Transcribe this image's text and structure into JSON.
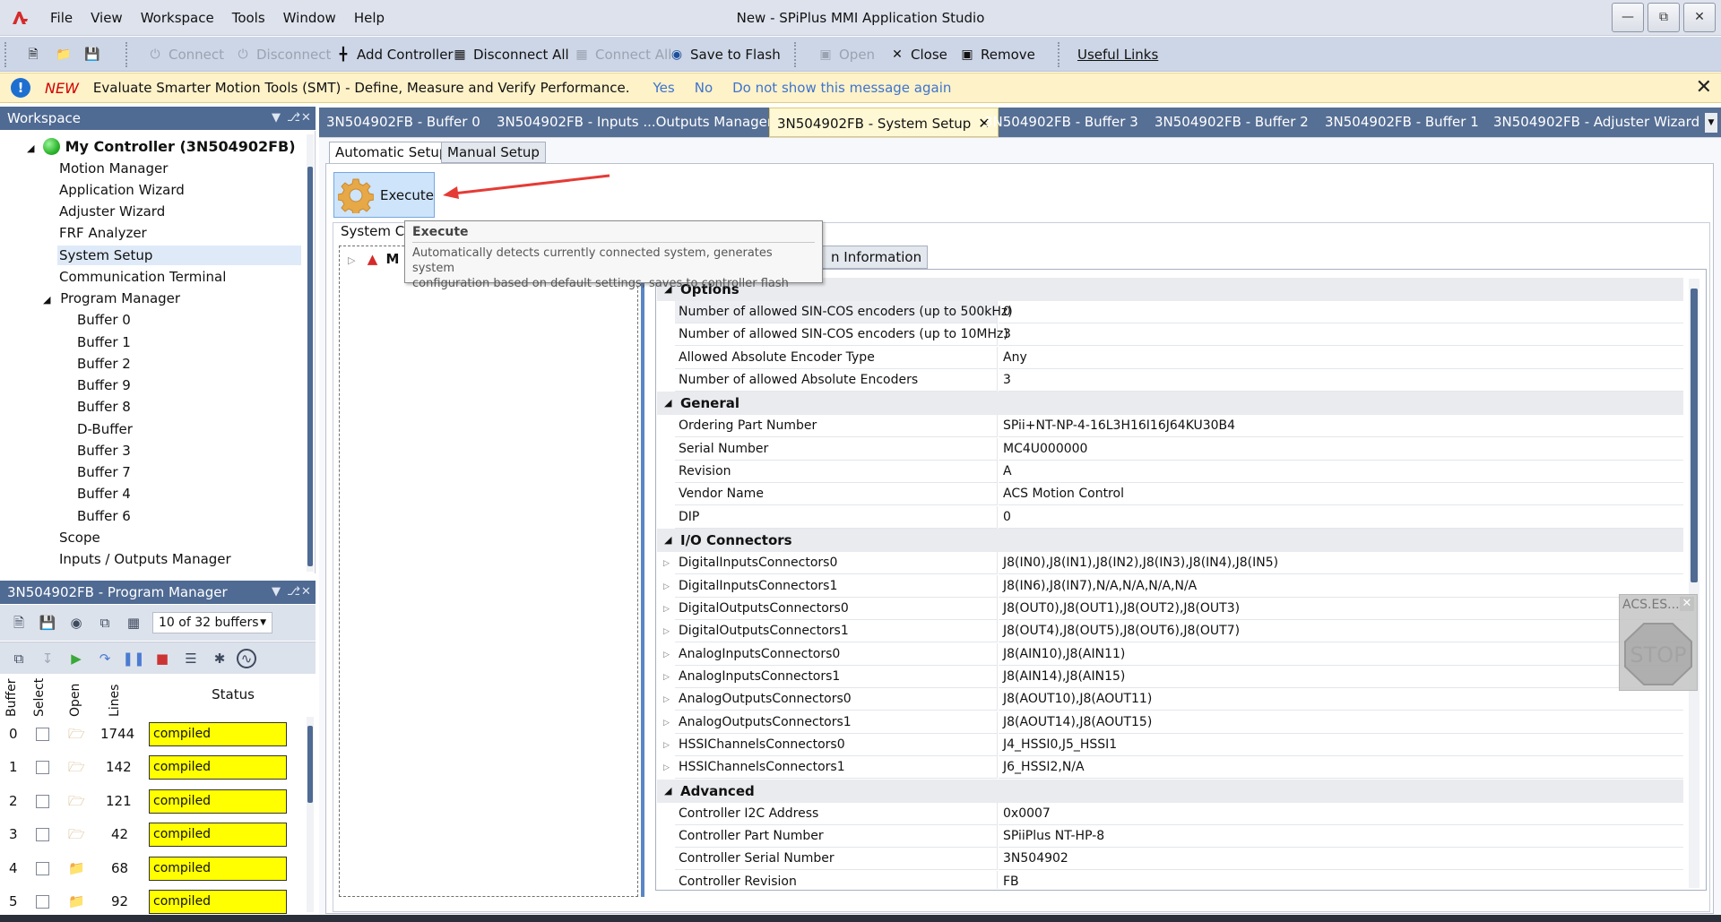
{
  "window": {
    "title": "New - SPiPlus MMI Application Studio"
  },
  "menu": [
    "File",
    "View",
    "Workspace",
    "Tools",
    "Window",
    "Help"
  ],
  "toolbar": {
    "connect": "Connect",
    "disconnect": "Disconnect",
    "add_controller": "Add Controller",
    "disconnect_all": "Disconnect All",
    "connect_all": "Connect All",
    "save_to_flash": "Save to Flash",
    "open": "Open",
    "close": "Close",
    "remove": "Remove",
    "useful_links": "Useful Links"
  },
  "notice": {
    "badge": "NEW",
    "text": "Evaluate Smarter Motion Tools (SMT) - Define, Measure and Verify Performance.",
    "yes": "Yes",
    "no": "No",
    "dont_show": "Do not show this message again"
  },
  "workspace": {
    "title": "Workspace",
    "controller": "My Controller (3N504902FB)",
    "items": [
      "Motion Manager",
      "Application Wizard",
      "Adjuster Wizard",
      "FRF Analyzer",
      "System Setup",
      "Communication Terminal"
    ],
    "program_manager": "Program Manager",
    "buffers": [
      "Buffer 0",
      "Buffer 1",
      "Buffer 2",
      "Buffer 9",
      "Buffer 8",
      "D-Buffer",
      "Buffer 3",
      "Buffer 7",
      "Buffer 4",
      "Buffer 6"
    ],
    "scope": "Scope",
    "io_manager": "Inputs / Outputs Manager",
    "selected": "System Setup"
  },
  "program_manager": {
    "title": "3N504902FB - Program Manager",
    "buffer_count": "10 of 32 buffers",
    "columns": {
      "buffer": "Buffer",
      "select": "Select",
      "open": "Open",
      "lines": "Lines",
      "status": "Status"
    },
    "rows": [
      {
        "buffer": "0",
        "lines": "1744",
        "status": "compiled"
      },
      {
        "buffer": "1",
        "lines": "142",
        "status": "compiled"
      },
      {
        "buffer": "2",
        "lines": "121",
        "status": "compiled"
      },
      {
        "buffer": "3",
        "lines": "42",
        "status": "compiled"
      },
      {
        "buffer": "4",
        "lines": "68",
        "status": "compiled"
      },
      {
        "buffer": "5",
        "lines": "92",
        "status": "compiled"
      }
    ],
    "status_color": "#ffff00"
  },
  "tabs": [
    "3N504902FB - Buffer 0",
    "3N504902FB - Inputs ...Outputs Manager",
    "3N504902FB - System Setup",
    "3N504902FB - Buffer 3",
    "3N504902FB - Buffer 2",
    "3N504902FB - Buffer 1",
    "3N504902FB - Adjuster Wizard"
  ],
  "active_tab": "3N504902FB - System Setup",
  "setup": {
    "subtabs": [
      "Automatic Setup",
      "Manual Setup"
    ],
    "execute": "Execute",
    "group_label": "System Co",
    "tree_root": "M",
    "info_tab": "n Information",
    "tooltip": {
      "title": "Execute",
      "line1": "Automatically detects currently connected system, generates system",
      "line2": "configuration based on default settings, saves to controller flash"
    }
  },
  "properties": [
    {
      "category": "Options",
      "rows": [
        {
          "name": "Number of allowed SIN-COS encoders (up to 500kHz)",
          "value": "0"
        },
        {
          "name": "Number of allowed SIN-COS encoders (up to 10MHz)",
          "value": "3"
        },
        {
          "name": "Allowed Absolute Encoder Type",
          "value": "Any"
        },
        {
          "name": "Number of allowed Absolute Encoders",
          "value": "3"
        }
      ]
    },
    {
      "category": "General",
      "rows": [
        {
          "name": "Ordering Part Number",
          "value": "SPii+NT-NP-4-16L3H16I16J64KU30B4"
        },
        {
          "name": "Serial Number",
          "value": "MC4U000000"
        },
        {
          "name": "Revision",
          "value": "A"
        },
        {
          "name": "Vendor Name",
          "value": "ACS Motion Control"
        },
        {
          "name": "DIP",
          "value": "0"
        }
      ]
    },
    {
      "category": "I/O Connectors",
      "rows": [
        {
          "name": "DigitalInputsConnectors0",
          "value": "J8(IN0),J8(IN1),J8(IN2),J8(IN3),J8(IN4),J8(IN5)"
        },
        {
          "name": "DigitalInputsConnectors1",
          "value": "J8(IN6),J8(IN7),N/A,N/A,N/A,N/A"
        },
        {
          "name": "DigitalOutputsConnectors0",
          "value": "J8(OUT0),J8(OUT1),J8(OUT2),J8(OUT3)"
        },
        {
          "name": "DigitalOutputsConnectors1",
          "value": "J8(OUT4),J8(OUT5),J8(OUT6),J8(OUT7)"
        },
        {
          "name": "AnalogInputsConnectors0",
          "value": "J8(AIN10),J8(AIN11)"
        },
        {
          "name": "AnalogInputsConnectors1",
          "value": "J8(AIN14),J8(AIN15)"
        },
        {
          "name": "AnalogOutputsConnectors0",
          "value": "J8(AOUT10),J8(AOUT11)"
        },
        {
          "name": "AnalogOutputsConnectors1",
          "value": "J8(AOUT14),J8(AOUT15)"
        },
        {
          "name": "HSSIChannelsConnectors0",
          "value": "J4_HSSI0,J5_HSSI1"
        },
        {
          "name": "HSSIChannelsConnectors1",
          "value": "J6_HSSI2,N/A"
        }
      ]
    },
    {
      "category": "Advanced",
      "rows": [
        {
          "name": "Controller I2C Address",
          "value": "0x0007"
        },
        {
          "name": "Controller Part Number",
          "value": "SPiiPlus NT-HP-8"
        },
        {
          "name": "Controller Serial Number",
          "value": "3N504902"
        },
        {
          "name": "Controller Revision",
          "value": "FB"
        }
      ]
    }
  ],
  "stop_widget": {
    "title": "ACS.ES...",
    "label": "STOP"
  },
  "colors": {
    "accent": "#4f6a93",
    "notice_bg": "#fef2c9",
    "execute_bg": "#cde4fb",
    "new_badge": "#d10000",
    "connected": "#2db52d"
  }
}
